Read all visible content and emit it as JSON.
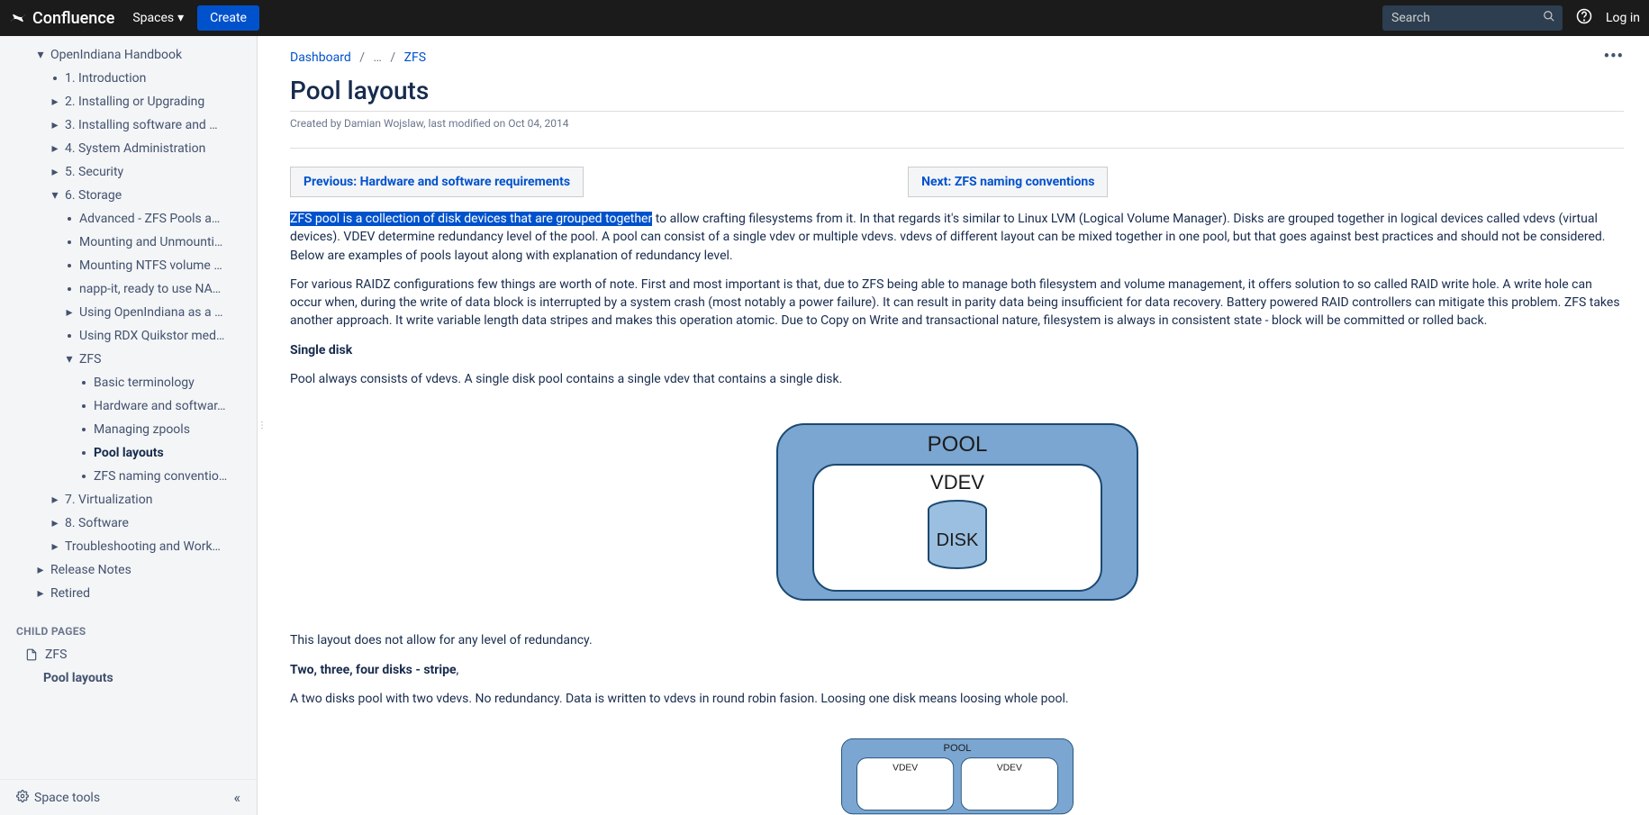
{
  "topbar": {
    "logo": "Confluence",
    "spaces": "Spaces",
    "create": "Create",
    "search_placeholder": "Search",
    "login": "Log in"
  },
  "breadcrumb": {
    "dashboard": "Dashboard",
    "ellipsis": "…",
    "parent": "ZFS"
  },
  "page": {
    "title": "Pool layouts",
    "meta": "Created by Damian Wojslaw, last modified on Oct 04, 2014"
  },
  "nav": {
    "prev": "Previous: Hardware and software requirements",
    "next": "Next: ZFS naming conventions"
  },
  "body": {
    "hl": "ZFS pool is a collection of disk devices that are grouped together",
    "p1_rest": " to allow crafting filesystems from it. In that regards it's similar to Linux LVM (Logical Volume Manager). Disks are grouped together in logical devices called vdevs (virtual devices). VDEV determine redundancy level of the pool. A pool can consist of a single vdev or multiple vdevs. vdevs of different layout can be mixed together in one pool, but that goes against best practices and should not be considered. Below are examples of pools layout along with explanation of redundancy level.",
    "p2": "For various RAIDZ configurations few things are worth of note. First and most important is that, due to ZFS being able to manage both filesystem and volume management, it offers solution to so called RAID write hole. A write hole can occur when, during the write of data block is interrupted by a system crash (most notably a power failure). It can result in parity data being insufficient for data recovery. Battery powered RAID controllers can mitigate this problem. ZFS takes another approach. It write variable length data stripes and makes this operation atomic. Due to Copy on Write and transactional nature, filesystem is always in consistent state - block will be committed or rolled back.",
    "h_single": "Single disk",
    "p_single": "Pool always consists of vdevs. A single disk pool contains a single vdev that contains a single disk.",
    "p_single2": "This layout does not allow for any level of redundancy.",
    "h_stripe": "Two, three, four disks - stripe",
    "p_stripe": "A two disks pool with two vdevs. No redundancy. Data is written to vdevs in round robin fasion. Loosing one disk means loosing whole pool."
  },
  "diagram": {
    "pool": "POOL",
    "vdev": "VDEV",
    "disk": "DISK"
  },
  "sidebar": {
    "tree": [
      {
        "label": "OpenIndiana Handbook",
        "indent": 0,
        "chev": "down"
      },
      {
        "label": "1. Introduction",
        "indent": 1,
        "dot": true
      },
      {
        "label": "2. Installing or Upgrading",
        "indent": 1,
        "chev": "right"
      },
      {
        "label": "3. Installing software and …",
        "indent": 1,
        "chev": "right"
      },
      {
        "label": "4. System Administration",
        "indent": 1,
        "chev": "right"
      },
      {
        "label": "5. Security",
        "indent": 1,
        "chev": "right"
      },
      {
        "label": "6. Storage",
        "indent": 1,
        "chev": "down"
      },
      {
        "label": "Advanced - ZFS Pools a…",
        "indent": 2,
        "dot": true
      },
      {
        "label": "Mounting and Unmounti…",
        "indent": 2,
        "dot": true
      },
      {
        "label": "Mounting NTFS volume …",
        "indent": 2,
        "dot": true
      },
      {
        "label": "napp-it, ready to use NA…",
        "indent": 2,
        "dot": true
      },
      {
        "label": "Using OpenIndiana as a …",
        "indent": 2,
        "chev": "right"
      },
      {
        "label": "Using RDX Quikstor med…",
        "indent": 2,
        "dot": true
      },
      {
        "label": "ZFS",
        "indent": 2,
        "chev": "down"
      },
      {
        "label": "Basic terminology",
        "indent": 3,
        "dot": true
      },
      {
        "label": "Hardware and softwar…",
        "indent": 3,
        "dot": true
      },
      {
        "label": "Managing zpools",
        "indent": 3,
        "dot": true
      },
      {
        "label": "Pool layouts",
        "indent": 3,
        "dot": true,
        "bold": true
      },
      {
        "label": "ZFS naming conventio…",
        "indent": 3,
        "dot": true
      },
      {
        "label": "7. Virtualization",
        "indent": 1,
        "chev": "right"
      },
      {
        "label": "8. Software",
        "indent": 1,
        "chev": "right"
      },
      {
        "label": "Troubleshooting and Work…",
        "indent": 1,
        "chev": "right"
      },
      {
        "label": "Release Notes",
        "indent": 0,
        "chev": "right"
      },
      {
        "label": "Retired",
        "indent": 0,
        "chev": "right"
      }
    ],
    "child_header": "CHILD PAGES",
    "child_zfs": "ZFS",
    "child_pool": "Pool layouts",
    "space_tools": "Space tools"
  }
}
